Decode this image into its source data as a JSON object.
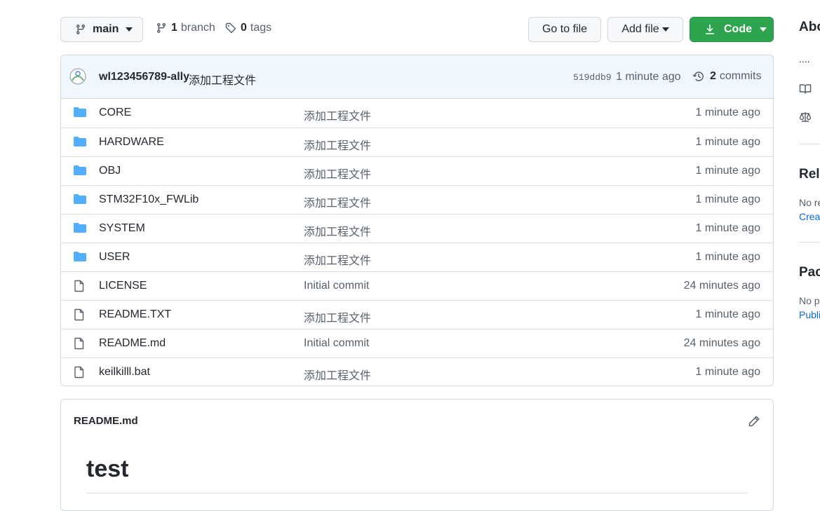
{
  "toolbar": {
    "branch_name": "main",
    "branch_count": "1",
    "branch_label": "branch",
    "tag_count": "0",
    "tag_label": "tags",
    "goto_file_label": "Go to file",
    "add_file_label": "Add file",
    "code_label": "Code"
  },
  "latest_commit": {
    "author": "wl123456789-ally",
    "message": "添加工程文件",
    "sha": "519ddb9",
    "time": "1 minute ago",
    "commit_count": "2",
    "commits_label": "commits"
  },
  "files": [
    {
      "type": "folder",
      "name": "CORE",
      "message": "添加工程文件",
      "age": "1 minute ago"
    },
    {
      "type": "folder",
      "name": "HARDWARE",
      "message": "添加工程文件",
      "age": "1 minute ago"
    },
    {
      "type": "folder",
      "name": "OBJ",
      "message": "添加工程文件",
      "age": "1 minute ago"
    },
    {
      "type": "folder",
      "name": "STM32F10x_FWLib",
      "message": "添加工程文件",
      "age": "1 minute ago"
    },
    {
      "type": "folder",
      "name": "SYSTEM",
      "message": "添加工程文件",
      "age": "1 minute ago"
    },
    {
      "type": "folder",
      "name": "USER",
      "message": "添加工程文件",
      "age": "1 minute ago"
    },
    {
      "type": "file",
      "name": "LICENSE",
      "message": "Initial commit",
      "age": "24 minutes ago"
    },
    {
      "type": "file",
      "name": "README.TXT",
      "message": "添加工程文件",
      "age": "1 minute ago"
    },
    {
      "type": "file",
      "name": "README.md",
      "message": "Initial commit",
      "age": "24 minutes ago"
    },
    {
      "type": "file",
      "name": "keilkilll.bat",
      "message": "添加工程文件",
      "age": "1 minute ago"
    }
  ],
  "readme": {
    "filename": "README.md",
    "heading": "test"
  },
  "sidebar": {
    "about_heading": "Abo",
    "ellipsis": "....",
    "releases_heading": "Rele",
    "releases_text": "No re",
    "releases_link": "Creat",
    "packages_heading": "Pack",
    "packages_text": "No p",
    "packages_link": "Publi"
  },
  "colors": {
    "folder_icon": "#54aeff",
    "code_button": "#2da44e",
    "commit_bar_bg": "#f0f7ff"
  }
}
